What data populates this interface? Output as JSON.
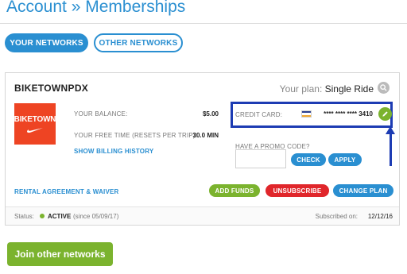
{
  "header": {
    "breadcrumb": "Account » Memberships"
  },
  "tabs": [
    {
      "label": "YOUR NETWORKS",
      "active": true
    },
    {
      "label": "OTHER NETWORKS",
      "active": false
    }
  ],
  "network": {
    "name": "BIKETOWNPDX",
    "plan_label": "Your plan:",
    "plan_value": "Single Ride",
    "logo_text": "BIKETOWN",
    "balance_label": "YOUR BALANCE:",
    "balance_value": "$5.00",
    "free_time_label": "YOUR FREE TIME (RESETS PER TRIP):",
    "free_time_value": "30.0 MIN",
    "billing_history_link": "SHOW BILLING HISTORY",
    "credit_card_label": "CREDIT CARD:",
    "credit_card_masked": "**** **** **** 3410",
    "promo_label": "HAVE A PROMO CODE?",
    "promo_value": "",
    "check_button": "CHECK",
    "apply_button": "APPLY",
    "rental_link": "RENTAL AGREEMENT & WAIVER",
    "add_funds_button": "ADD FUNDS",
    "unsubscribe_button": "UNSUBSCRIBE",
    "change_plan_button": "CHANGE PLAN",
    "status_label": "Status:",
    "status_value": "ACTIVE",
    "status_since": "(since 05/09/17)",
    "subscribed_label": "Subscribed on:",
    "subscribed_value": "12/12/16"
  },
  "join_button": "Join other networks",
  "colors": {
    "primary_blue": "#2a8fd1",
    "green": "#7bb32e",
    "red": "#e0262b",
    "brand_orange": "#ee4423",
    "annotation_blue": "#1d3cb3"
  }
}
